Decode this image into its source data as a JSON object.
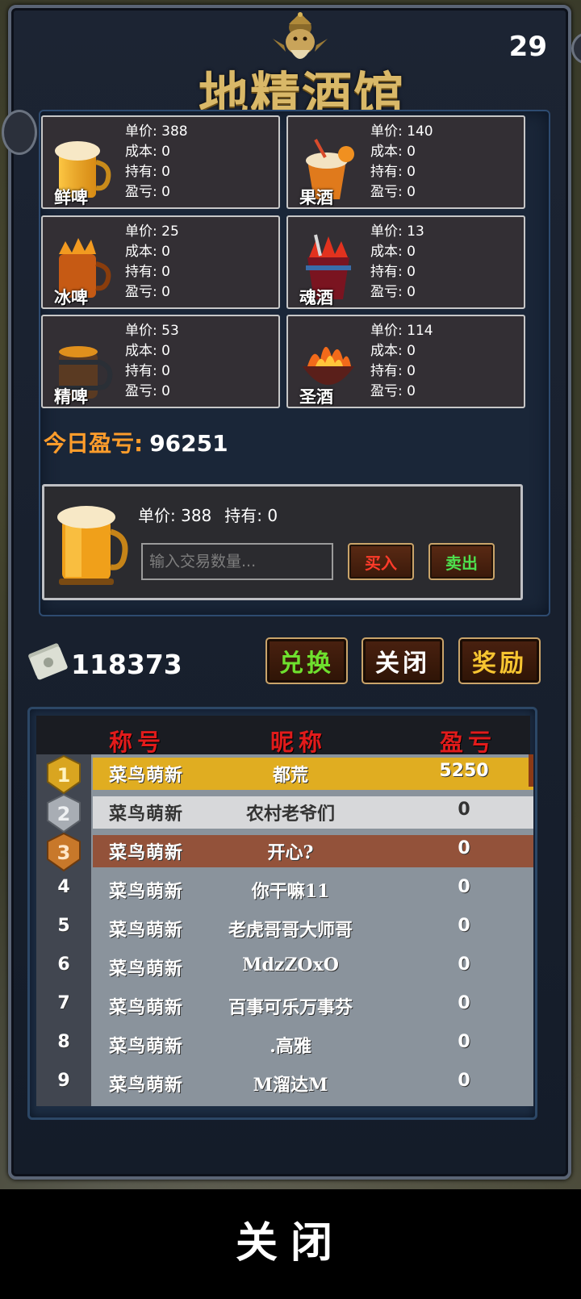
{
  "header": {
    "title": "地精酒馆",
    "timer": "29"
  },
  "drinks": [
    {
      "name": "鲜啤",
      "price": "单价: 388",
      "cost": "成本: 0",
      "held": "持有: 0",
      "pl": "盈亏: 0"
    },
    {
      "name": "果酒",
      "price": "单价: 140",
      "cost": "成本: 0",
      "held": "持有: 0",
      "pl": "盈亏: 0"
    },
    {
      "name": "冰啤",
      "price": "单价: 25",
      "cost": "成本: 0",
      "held": "持有: 0",
      "pl": "盈亏: 0"
    },
    {
      "name": "魂酒",
      "price": "单价: 13",
      "cost": "成本: 0",
      "held": "持有: 0",
      "pl": "盈亏: 0"
    },
    {
      "name": "精啤",
      "price": "单价: 53",
      "cost": "成本: 0",
      "held": "持有: 0",
      "pl": "盈亏: 0"
    },
    {
      "name": "圣酒",
      "price": "单价: 114",
      "cost": "成本: 0",
      "held": "持有: 0",
      "pl": "盈亏: 0"
    }
  ],
  "today": {
    "label": "今日盈亏:",
    "value": "96251"
  },
  "trade": {
    "price": "单价: 388",
    "held": "持有: 0",
    "placeholder": "输入交易数量...",
    "buy": "买入",
    "sell": "卖出"
  },
  "wallet": {
    "money": "118373",
    "icon": "cash-stack-icon"
  },
  "actions": {
    "exchange": "兑换",
    "close": "关闭",
    "reward": "奖励"
  },
  "ranking": {
    "headers": [
      "称号",
      "昵称",
      "盈亏"
    ],
    "rows": [
      {
        "rank": "1",
        "title": "菜鸟萌新",
        "name": "都荒",
        "pl": "5250"
      },
      {
        "rank": "2",
        "title": "菜鸟萌新",
        "name": "农村老爷们",
        "pl": "0"
      },
      {
        "rank": "3",
        "title": "菜鸟萌新",
        "name": "开心?",
        "pl": "0"
      },
      {
        "rank": "4",
        "title": "菜鸟萌新",
        "name": "你干嘛11",
        "pl": "0"
      },
      {
        "rank": "5",
        "title": "菜鸟萌新",
        "name": "老虎哥哥大师哥",
        "pl": "0"
      },
      {
        "rank": "6",
        "title": "菜鸟萌新",
        "name": "MdzZOxO",
        "pl": "0"
      },
      {
        "rank": "7",
        "title": "菜鸟萌新",
        "name": "百事可乐万事芬",
        "pl": "0"
      },
      {
        "rank": "8",
        "title": "菜鸟萌新",
        "name": ".高雅",
        "pl": "0"
      },
      {
        "rank": "9",
        "title": "菜鸟萌新",
        "name": "M溜达M",
        "pl": "0"
      }
    ]
  },
  "footer": {
    "close": "关闭"
  },
  "colors": {
    "gold": "#e0ad21",
    "silver": "#d7d8da",
    "bronze": "#93523a",
    "red_header": "#e11b1b",
    "orange_label": "#ff9d2b"
  }
}
